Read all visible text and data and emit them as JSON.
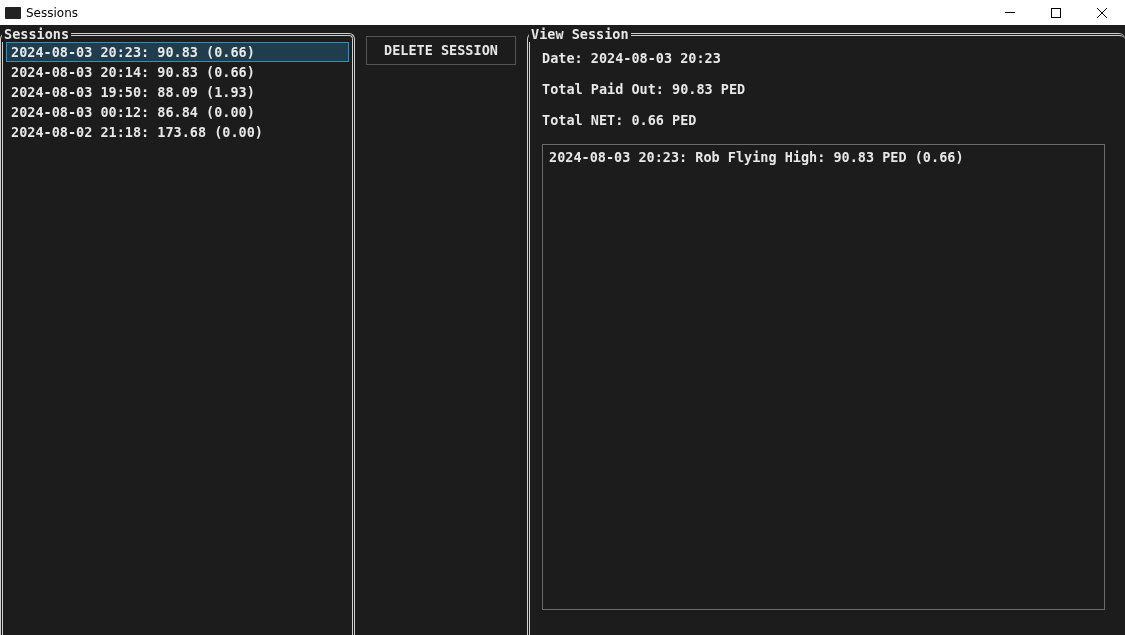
{
  "window": {
    "title": "Sessions"
  },
  "sessions": {
    "title": "Sessions",
    "items": [
      {
        "label": "2024-08-03 20:23: 90.83 (0.66)",
        "selected": true
      },
      {
        "label": "2024-08-03 20:14: 90.83 (0.66)",
        "selected": false
      },
      {
        "label": "2024-08-03 19:50: 88.09 (1.93)",
        "selected": false
      },
      {
        "label": "2024-08-03 00:12: 86.84 (0.00)",
        "selected": false
      },
      {
        "label": "2024-08-02 21:18: 173.68 (0.00)",
        "selected": false
      }
    ]
  },
  "delete_button": "DELETE SESSION",
  "view": {
    "title": "View Session",
    "fields": [
      "Date: 2024-08-03 20:23",
      "Total Paid Out: 90.83 PED",
      "Total NET: 0.66 PED"
    ],
    "entries": [
      "2024-08-03 20:23: Rob Flying High: 90.83 PED (0.66)"
    ]
  }
}
